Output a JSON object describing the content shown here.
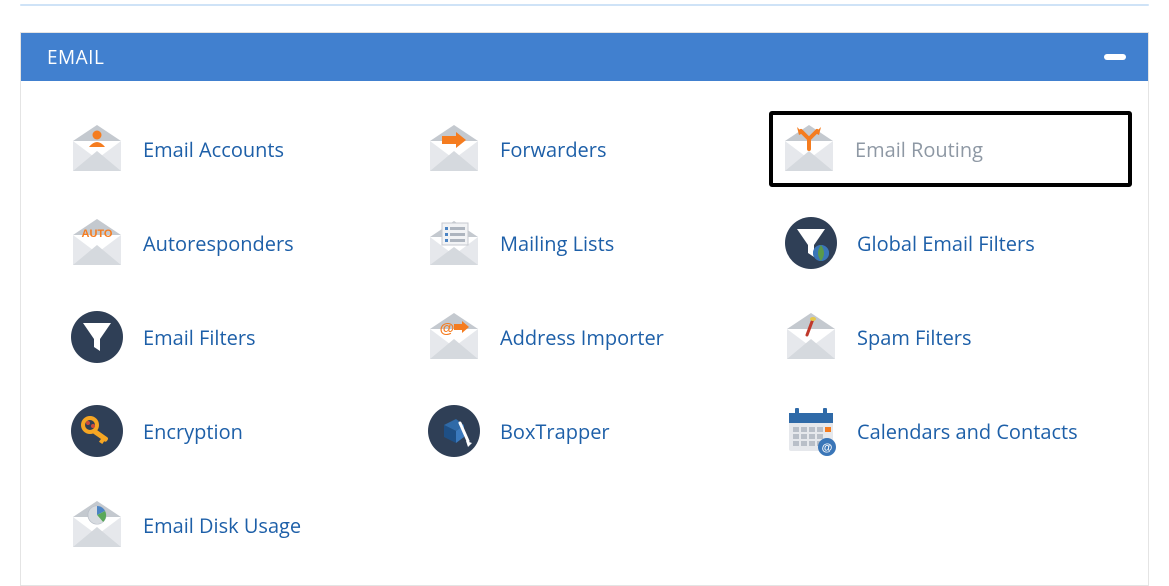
{
  "panel": {
    "title": "EMAIL"
  },
  "items": [
    {
      "label": "Email Accounts"
    },
    {
      "label": "Forwarders"
    },
    {
      "label": "Email Routing"
    },
    {
      "label": "Autoresponders"
    },
    {
      "label": "Mailing Lists"
    },
    {
      "label": "Global Email Filters"
    },
    {
      "label": "Email Filters"
    },
    {
      "label": "Address Importer"
    },
    {
      "label": "Spam Filters"
    },
    {
      "label": "Encryption"
    },
    {
      "label": "BoxTrapper"
    },
    {
      "label": "Calendars and Contacts"
    },
    {
      "label": "Email Disk Usage"
    }
  ],
  "colors": {
    "header": "#4180cf",
    "link": "#1d5fa8",
    "orange": "#f57c1f",
    "darkNavy": "#2f3f56"
  }
}
